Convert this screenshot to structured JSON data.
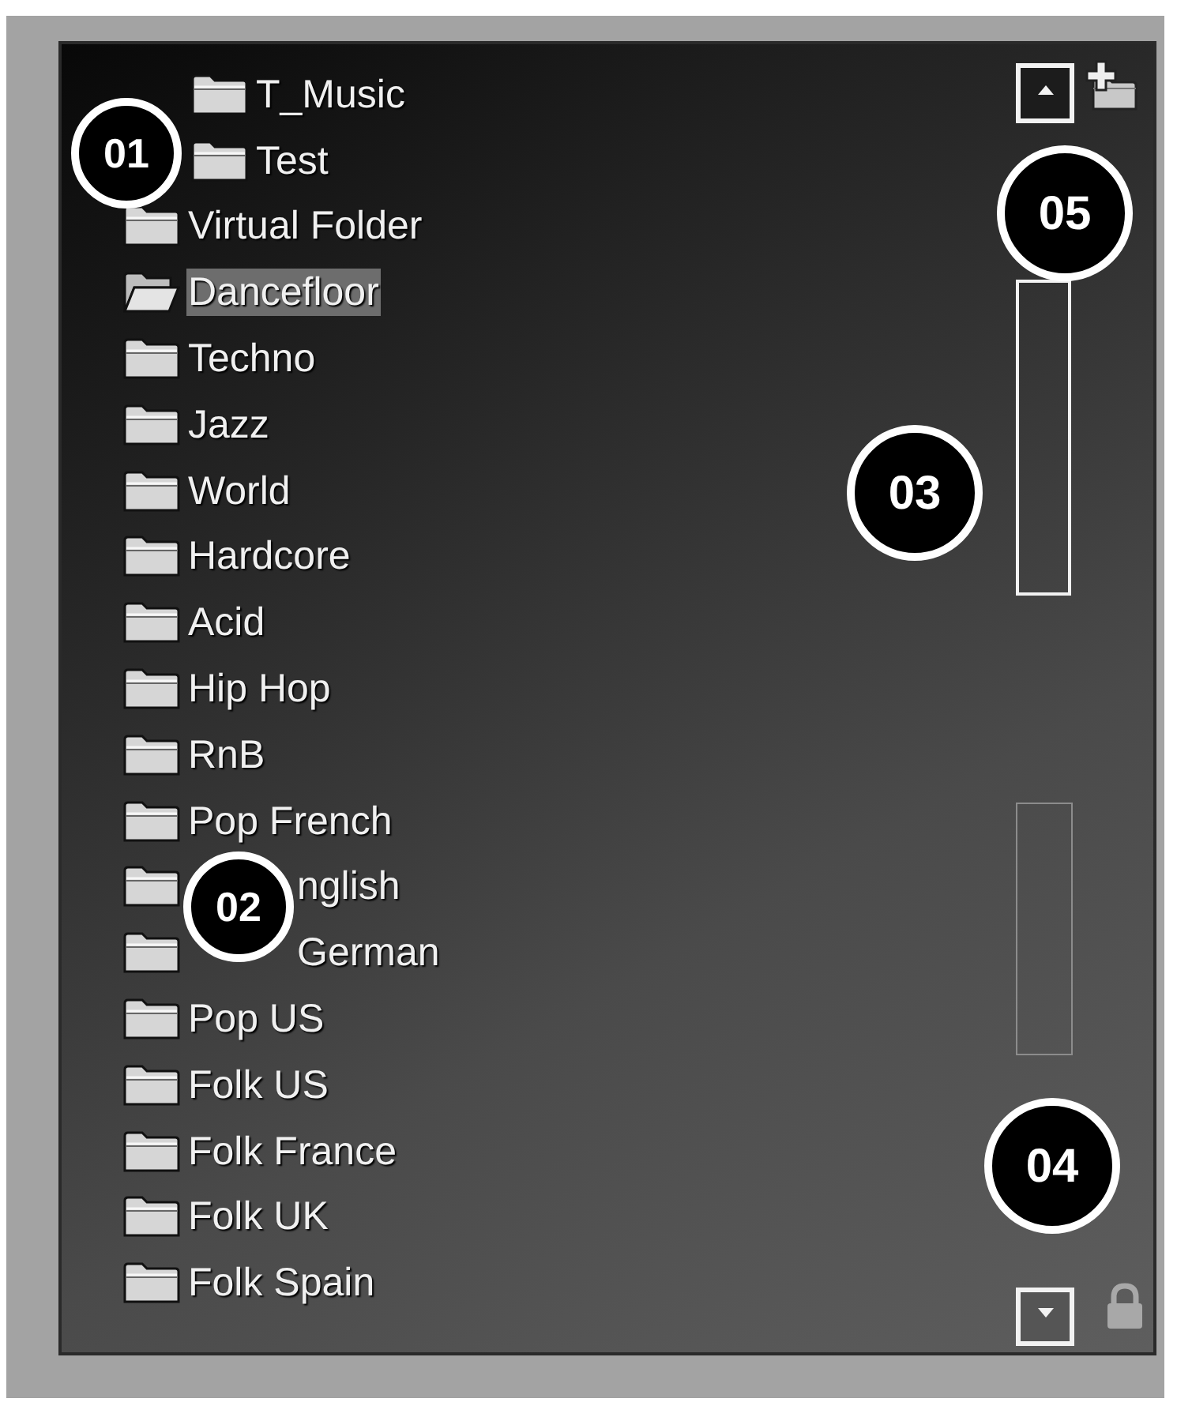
{
  "tree": {
    "items": [
      {
        "children": [
          {
            "label": "T_Music",
            "selected": false
          },
          {
            "label": "Test",
            "selected": false
          }
        ]
      },
      {
        "label": "Virtual Folder",
        "selected": false
      },
      {
        "label": "Dancefloor",
        "selected": true
      },
      {
        "label": "Techno",
        "selected": false
      },
      {
        "label": "Jazz",
        "selected": false
      },
      {
        "label": "World",
        "selected": false
      },
      {
        "label": "Hardcore",
        "selected": false
      },
      {
        "label": "Acid",
        "selected": false
      },
      {
        "label": "Hip Hop",
        "selected": false
      },
      {
        "label": "RnB",
        "selected": false
      },
      {
        "label": "Pop French",
        "selected": false
      },
      {
        "label": "nglish",
        "selected": false
      },
      {
        "label": "German",
        "selected": false
      },
      {
        "label": "Pop US",
        "selected": false
      },
      {
        "label": "Folk US",
        "selected": false
      },
      {
        "label": "Folk France",
        "selected": false
      },
      {
        "label": "Folk UK",
        "selected": false
      },
      {
        "label": "Folk Spain",
        "selected": false
      }
    ]
  },
  "callouts": [
    {
      "number": "01"
    },
    {
      "number": "02"
    },
    {
      "number": "03"
    },
    {
      "number": "04"
    },
    {
      "number": "05"
    }
  ]
}
